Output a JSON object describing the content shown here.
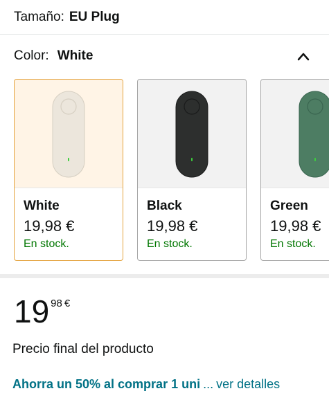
{
  "size": {
    "label": "Tamaño:",
    "value": "EU Plug"
  },
  "color": {
    "label": "Color:",
    "value": "White",
    "toggle_icon": "chevron-up-icon"
  },
  "swatches": [
    {
      "name": "White",
      "price": "19,98 €",
      "stock": "En stock.",
      "selected": true,
      "device_color": "#ece6dc",
      "device_stroke": "#d6cfc2"
    },
    {
      "name": "Black",
      "price": "19,98 €",
      "stock": "En stock.",
      "selected": false,
      "device_color": "#2d2f2e",
      "device_stroke": "#1a1b1b"
    },
    {
      "name": "Green",
      "price": "19,98 €",
      "stock": "En stock.",
      "selected": false,
      "device_color": "#4d7d63",
      "device_stroke": "#3a6550"
    }
  ],
  "price": {
    "whole": "19",
    "fraction": "98",
    "currency": "€",
    "note": "Precio final del producto"
  },
  "savings": {
    "text": "Ahorra un 50% al comprar 1 uni",
    "ellipsis": "...",
    "link": "ver detalles"
  },
  "colors": {
    "stock_green": "#007600",
    "link_teal": "#007185",
    "selected_border": "#e4a33d"
  }
}
